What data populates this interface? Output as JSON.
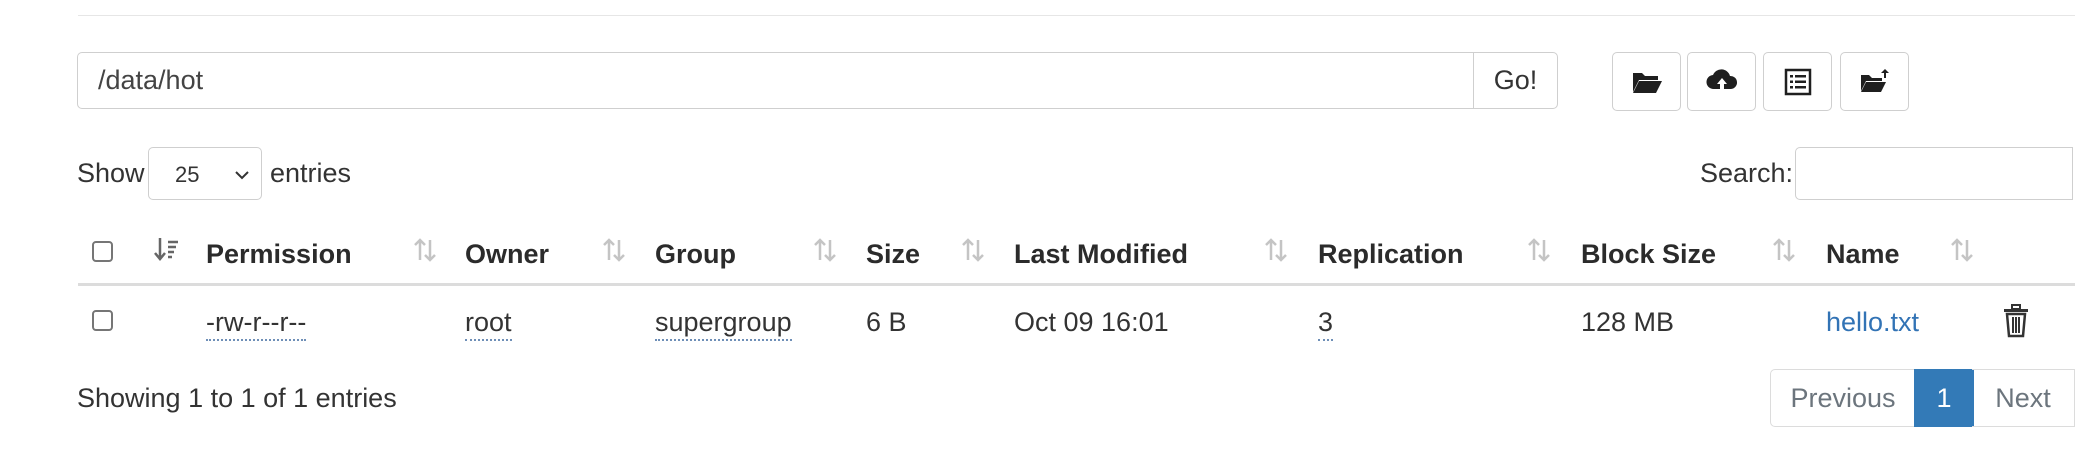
{
  "browser": {
    "path_value": "/data/hot",
    "go_label": "Go!",
    "tools": [
      "open-folder-icon",
      "upload-cloud-icon",
      "list-details-icon",
      "move-folder-icon"
    ]
  },
  "length": {
    "show_label": "Show",
    "value": "25",
    "entries_label": "entries"
  },
  "search": {
    "label": "Search:",
    "value": ""
  },
  "table": {
    "headers": [
      "Permission",
      "Owner",
      "Group",
      "Size",
      "Last Modified",
      "Replication",
      "Block Size",
      "Name"
    ],
    "rows": [
      {
        "permission": "-rw-r--r--",
        "owner": "root",
        "group": "supergroup",
        "size": "6 B",
        "last_modified": "Oct 09 16:01",
        "replication": "3",
        "block_size": "128 MB",
        "name": "hello.txt"
      }
    ]
  },
  "footer": {
    "info": "Showing 1 to 1 of 1 entries",
    "previous": "Previous",
    "current_page": "1",
    "next": "Next"
  },
  "colors": {
    "link": "#3273b5",
    "active_page": "#337ab7",
    "border": "#cfcfcf"
  }
}
